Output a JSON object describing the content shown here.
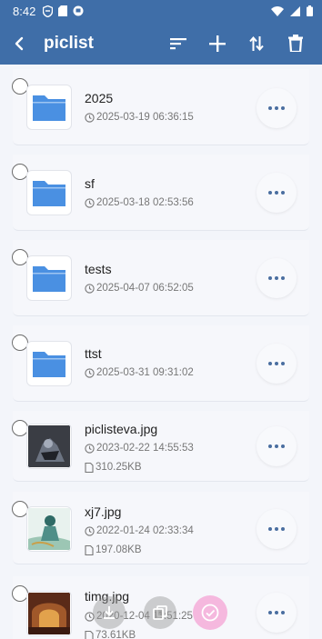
{
  "status_bar": {
    "time": "8:42"
  },
  "app_bar": {
    "title": "piclist"
  },
  "files": [
    {
      "name": "2025",
      "type": "folder",
      "date": "2025-03-19 06:36:15"
    },
    {
      "name": "sf",
      "type": "folder",
      "date": "2025-03-18 02:53:56"
    },
    {
      "name": "tests",
      "type": "folder",
      "date": "2025-04-07 06:52:05"
    },
    {
      "name": "ttst",
      "type": "folder",
      "date": "2025-03-31 09:31:02"
    },
    {
      "name": "piclisteva.jpg",
      "type": "image",
      "date": "2023-02-22 14:55:53",
      "size": "310.25KB"
    },
    {
      "name": "xj7.jpg",
      "type": "image",
      "date": "2022-01-24 02:33:34",
      "size": "197.08KB"
    },
    {
      "name": "timg.jpg",
      "type": "image",
      "date": "2020-12-04 11:51:25",
      "size": "73.61KB"
    }
  ],
  "colors": {
    "accent": "#3f6ea8",
    "folder": "#4a90e2",
    "fab_pink": "#f5b8de"
  }
}
